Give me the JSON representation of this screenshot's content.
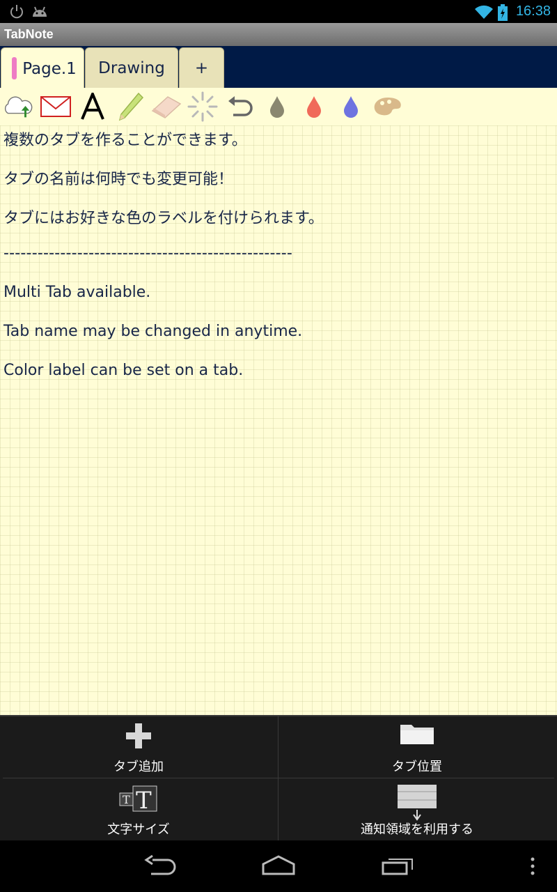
{
  "status_bar": {
    "time": "16:38"
  },
  "app": {
    "title": "TabNote"
  },
  "tabs": [
    {
      "label": "Page.1",
      "label_color": "#ee7bc4",
      "active": true
    },
    {
      "label": "Drawing",
      "active": false
    },
    {
      "label": "+",
      "active": false
    }
  ],
  "toolbar": {
    "icons": [
      "cloud-upload-icon",
      "mail-icon",
      "text-icon",
      "pencil-icon",
      "eraser-icon",
      "clear-icon",
      "undo-icon",
      "gray-ink-icon",
      "red-ink-icon",
      "blue-ink-icon",
      "palette-icon"
    ],
    "ink_colors": {
      "gray": "#8a8770",
      "red": "#f06a5a",
      "blue": "#6e73e0",
      "palette": "#d9b98a"
    }
  },
  "note": {
    "lines": [
      "複数のタブを作ることができます。",
      "タブの名前は何時でも変更可能！",
      "タブにはお好きな色のラベルを付けられます。",
      "---------------------------------------------------",
      "Multi Tab available.",
      "Tab name may be changed in anytime.",
      "Color label can be set on a tab."
    ]
  },
  "menu": {
    "add_tab": "タブ追加",
    "tab_position": "タブ位置",
    "text_size": "文字サイズ",
    "notification": "通知領域を利用する"
  }
}
